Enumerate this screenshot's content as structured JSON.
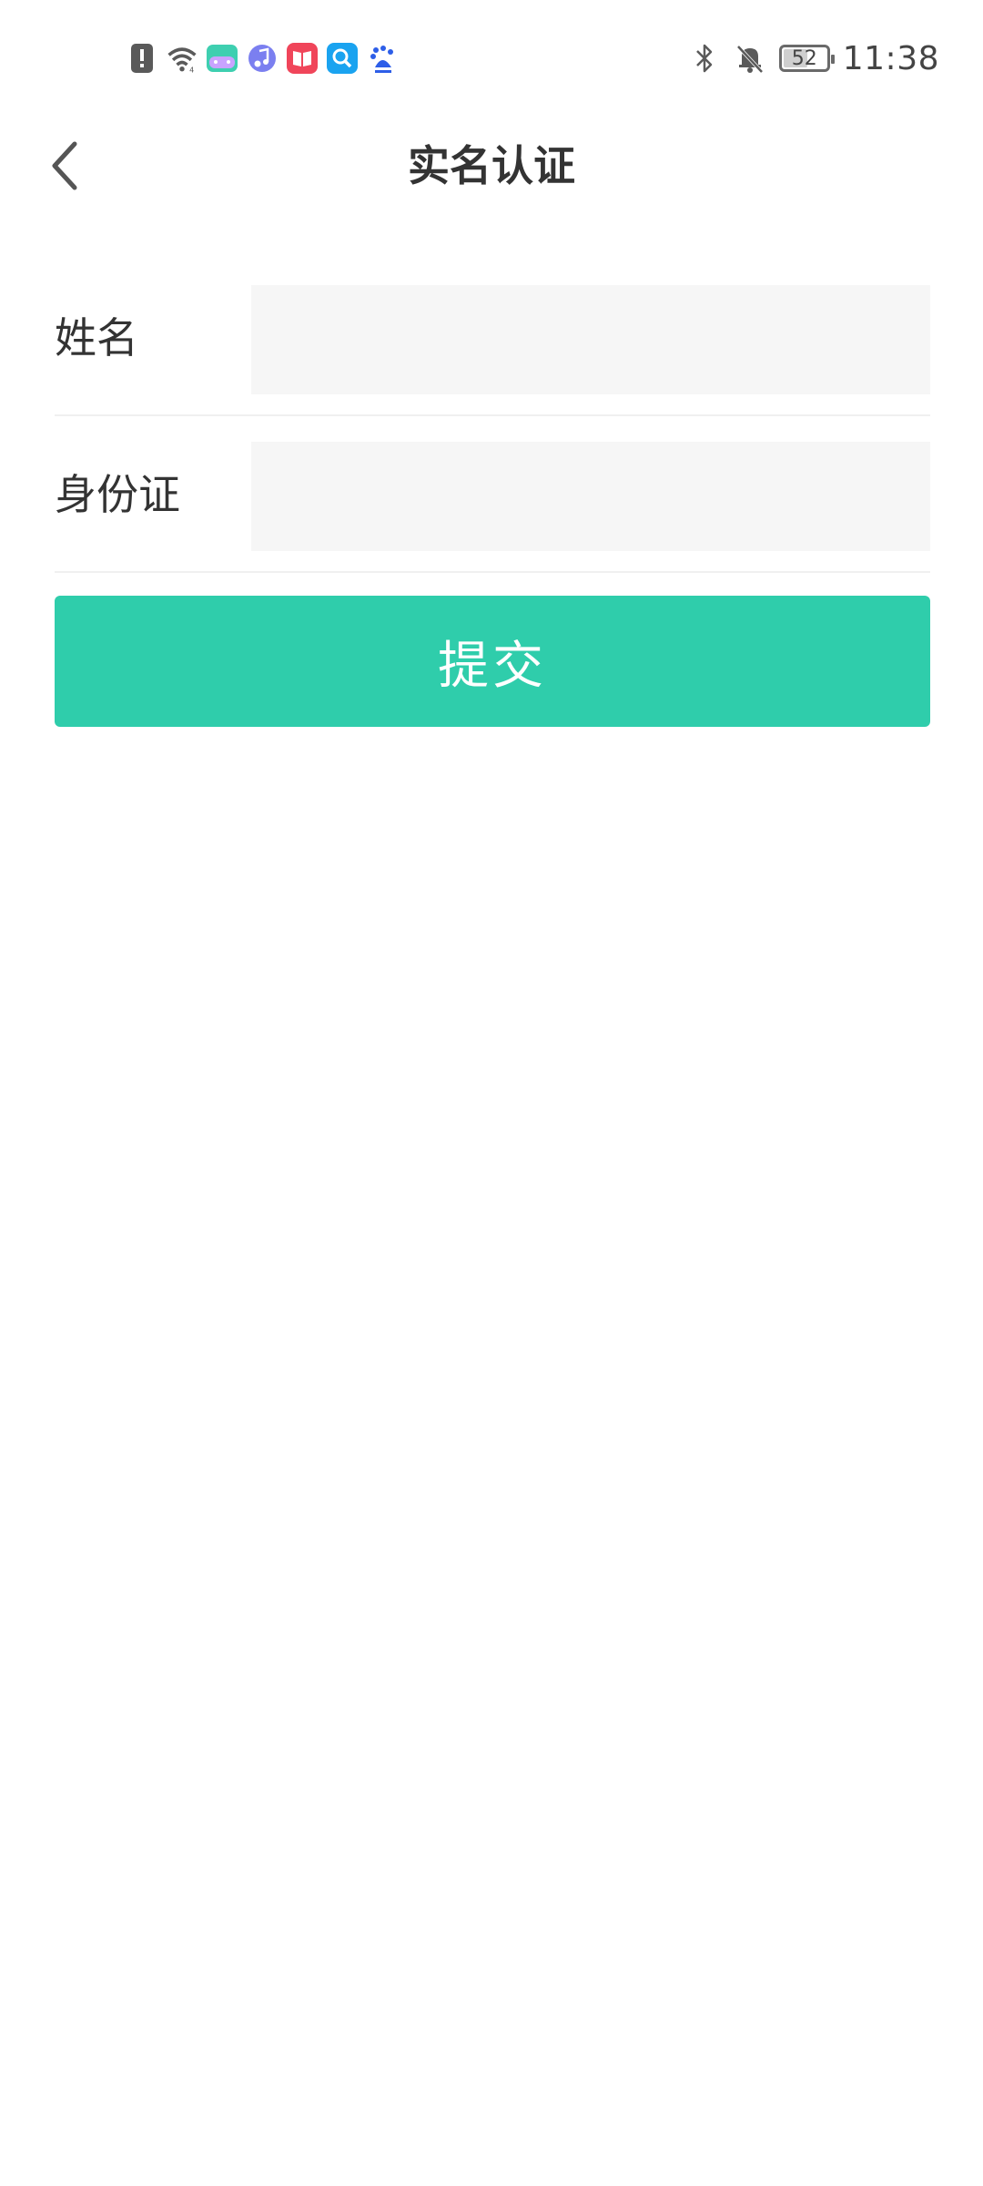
{
  "status_bar": {
    "left_icons": [
      "alert-icon",
      "wifi-icon",
      "game-controller-app-icon",
      "music-app-icon",
      "book-app-icon",
      "search-app-icon",
      "baidu-app-icon"
    ],
    "right_icons": [
      "bluetooth-icon",
      "bell-muted-icon",
      "battery-icon"
    ],
    "battery_level": "52",
    "time": "11:38"
  },
  "header": {
    "title": "实名认证",
    "back_icon": "chevron-left-icon"
  },
  "form": {
    "name_label": "姓名",
    "name_value": "",
    "id_label": "身份证",
    "id_value": ""
  },
  "submit": {
    "label": "提交"
  },
  "colors": {
    "accent": "#2fcdab",
    "input_bg": "#f6f6f6",
    "text": "#333333"
  }
}
